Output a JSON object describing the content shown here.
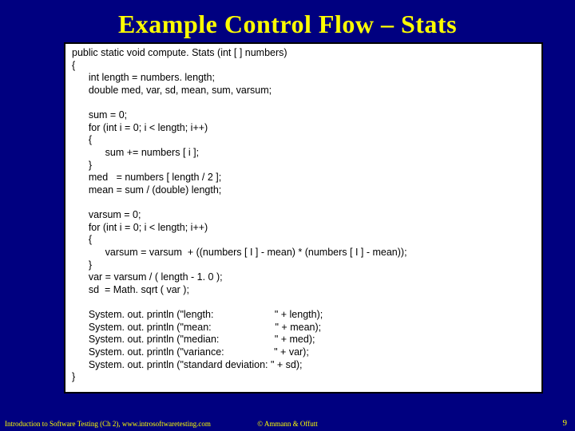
{
  "title": "Example Control Flow – Stats",
  "code": "public static void compute. Stats (int [ ] numbers)\n{\n      int length = numbers. length;\n      double med, var, sd, mean, sum, varsum;\n\n      sum = 0;\n      for (int i = 0; i < length; i++)\n      {\n            sum += numbers [ i ];\n      }\n      med   = numbers [ length / 2 ];\n      mean = sum / (double) length;\n\n      varsum = 0;\n      for (int i = 0; i < length; i++)\n      {\n            varsum = varsum  + ((numbers [ I ] - mean) * (numbers [ I ] - mean));\n      }\n      var = varsum / ( length - 1. 0 );\n      sd  = Math. sqrt ( var );\n\n      System. out. println (\"length:                      \" + length);\n      System. out. println (\"mean:                       \" + mean);\n      System. out. println (\"median:                    \" + med);\n      System. out. println (\"variance:                  \" + var);\n      System. out. println (\"standard deviation: \" + sd);\n}",
  "footer": {
    "left": "Introduction to Software Testing (Ch 2), www.introsoftwaretesting.com",
    "center": "© Ammann & Offutt",
    "right": "9"
  }
}
